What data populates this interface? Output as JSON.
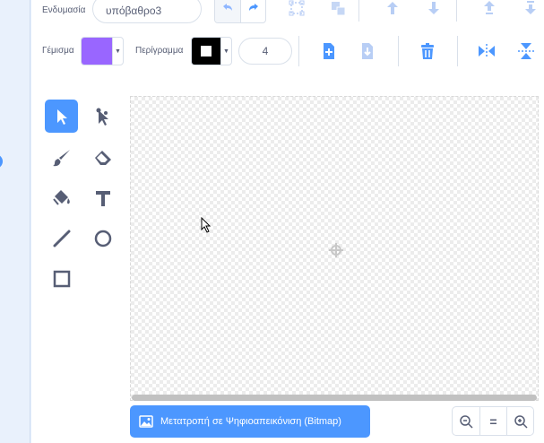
{
  "toolbar": {
    "costume_label": "Ενδυμασία",
    "costume_name": "υπόβαθρο3",
    "fill_label": "Γέμισμα",
    "outline_label": "Περίγραμμα",
    "outline_width": "4",
    "fill_color": "#9966ff",
    "outline_color": "#000000"
  },
  "canvas": {
    "convert_button_label": "Μετατροπή σε Ψηφιοαπεικόνιση (Bitmap)",
    "zoom_reset_label": "="
  },
  "colors": {
    "accent": "#4c97ff",
    "delete": "#4c97ff",
    "text": "#575e75"
  }
}
